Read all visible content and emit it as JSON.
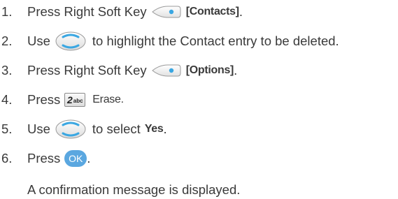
{
  "steps": [
    {
      "number": "1.",
      "parts": {
        "a": "Press Right Soft Key",
        "b": "[Contacts]",
        "end": "."
      }
    },
    {
      "number": "2.",
      "parts": {
        "a": "Use",
        "b": "to highlight the Contact entry to be deleted."
      }
    },
    {
      "number": "3.",
      "parts": {
        "a": "Press Right Soft Key",
        "b": "[Options]",
        "end": "."
      }
    },
    {
      "number": "4.",
      "parts": {
        "a": "Press",
        "key": "2",
        "key_letters": "abc",
        "b": "Erase."
      }
    },
    {
      "number": "5.",
      "parts": {
        "a": "Use",
        "b": "to select",
        "c": "Yes",
        "end": "."
      }
    },
    {
      "number": "6.",
      "parts": {
        "a": "Press",
        "ok": "OK",
        "end": "."
      }
    }
  ],
  "note": "A confirmation message is displayed.",
  "icons": {
    "soft_key": "right-soft-key-icon",
    "nav_key": "navigation-key-icon",
    "number_key": "2abc-key-icon",
    "ok_key": "ok-button-icon"
  },
  "colors": {
    "text": "#3a3a3a",
    "ok_button": "#5aa7e0",
    "key_dot": "#3aa7e2"
  }
}
